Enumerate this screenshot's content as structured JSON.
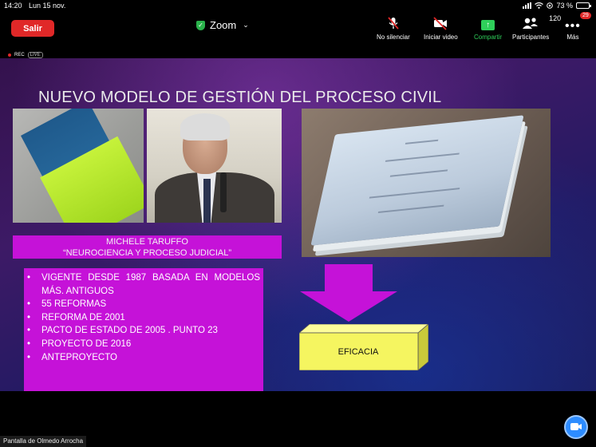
{
  "status_bar": {
    "time": "14:20",
    "date": "Lun 15 nov.",
    "battery": "73 %",
    "battery_level": 0.73
  },
  "top_bar": {
    "leave_label": "Salir",
    "meeting_title": "Zoom",
    "toolbar": [
      {
        "key": "mute",
        "label": "No silenciar",
        "icon": "mic-muted-icon"
      },
      {
        "key": "video",
        "label": "Iniciar video",
        "icon": "video-off-icon"
      },
      {
        "key": "share",
        "label": "Compartir",
        "icon": "share-screen-icon",
        "color": "#2fcf5a"
      },
      {
        "key": "participants",
        "label": "Participantes",
        "icon": "participants-icon",
        "count": "120"
      },
      {
        "key": "more",
        "label": "Más",
        "icon": "more-icon",
        "badge": "29"
      }
    ]
  },
  "recording": {
    "rec": "REC",
    "live": "LIVE"
  },
  "slide": {
    "title": "NUEVO MODELO DE GESTIÓN DEL PROCESO CIVIL",
    "author_name": "MICHELE TARUFFO",
    "book_title": "“NEUROCIENCIA Y PROCESO JUDICIAL”",
    "bullets": [
      "VIGENTE DESDE 1987 BASADA EN MODELOS",
      "MÁS. ANTIGUOS",
      "55 REFORMAS",
      "REFORMA DE 2001",
      "PACTO DE ESTADO DE 2005 .  PUNTO 23",
      "PROYECTO DE 2016",
      "ANTEPROYECTO"
    ],
    "result_label": "EFICACIA",
    "colors": {
      "magenta": "#c512d8",
      "yellow": "#f5f560",
      "background": "#2d1660"
    }
  },
  "footer": {
    "screen_owner": "Pantalla de Olmedo Arrocha"
  }
}
